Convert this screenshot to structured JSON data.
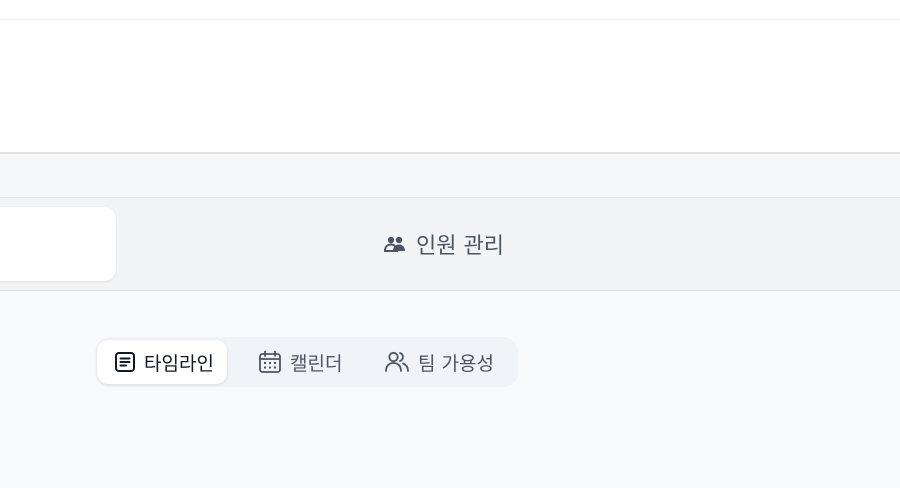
{
  "nav": {
    "people_tab_label": "인원 관리",
    "people_icon": "users-group-icon"
  },
  "view_switcher": {
    "active_view": "timeline",
    "views": [
      {
        "key": "timeline",
        "label": "타임라인",
        "icon": "list-box-icon"
      },
      {
        "key": "calendar",
        "label": "캘린더",
        "icon": "calendar-icon"
      },
      {
        "key": "availability",
        "label": "팀 가용성",
        "icon": "users-icon"
      }
    ]
  },
  "colors": {
    "background": "#f8fafc",
    "nav_background": "#f3f4f6",
    "active_text": "#111827",
    "inactive_text": "#4b5563"
  }
}
